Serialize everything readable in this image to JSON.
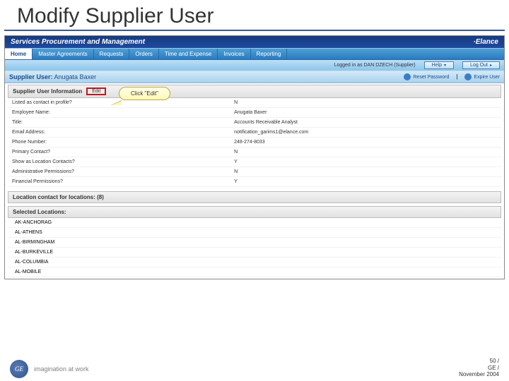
{
  "slide_title": "Modify Supplier User",
  "brandbar": {
    "left": "Services Procurement and Management",
    "right": "·Elance"
  },
  "tabs": [
    "Home",
    "Master Agreements",
    "Requests",
    "Orders",
    "Time and Expense",
    "Invoices",
    "Reporting"
  ],
  "active_tab": 0,
  "subbar": {
    "logged_in": "Logged in as DAN DZECH (Supplier)",
    "help": "Help",
    "logout": "Log Out"
  },
  "page_header": {
    "label": "Supplier User:",
    "value": "Anugata Baxer",
    "reset": "Reset Password",
    "expire": "Expire User"
  },
  "callout": "Click \"Edit\"",
  "section1": {
    "title": "Supplier User Information",
    "edit": "Edit",
    "rows": [
      {
        "label": "Listed as contact in profile?",
        "value": "N"
      },
      {
        "label": "Employee Name:",
        "value": "Anugata Baxer"
      },
      {
        "label": "Title:",
        "value": "Accounts Receivable Analyst"
      },
      {
        "label": "Email Address:",
        "value": "notification_garims1@elance.com"
      },
      {
        "label": "Phone Number:",
        "value": "248-274-8033"
      },
      {
        "label": "Primary Contact?",
        "value": "N"
      },
      {
        "label": "Show as Location Contacts?",
        "value": "Y"
      },
      {
        "label": "Administrative Permissions?",
        "value": "N"
      },
      {
        "label": "Financial Permissions?",
        "value": "Y"
      }
    ]
  },
  "section2": {
    "title": "Location contact for locations: (8)"
  },
  "section3": {
    "title": "Selected Locations:",
    "items": [
      "AK-ANCHORAG",
      "AL-ATHENS",
      "AL-BIRMINGHAM",
      "AL-BURKEVILLE",
      "AL-COLUMBIA",
      "AL-MOBILE"
    ]
  },
  "footer": {
    "tagline": "imagination at work",
    "page": "50 /",
    "company": "GE /",
    "date": "November 2004"
  }
}
